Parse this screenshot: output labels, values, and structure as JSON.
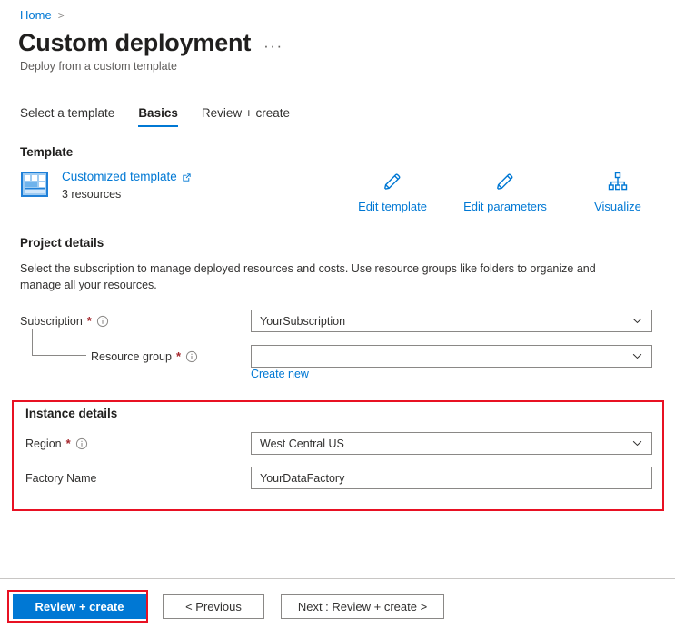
{
  "breadcrumb": {
    "items": [
      {
        "label": "Home",
        "link": true
      }
    ],
    "separator": ">"
  },
  "header": {
    "title": "Custom deployment",
    "subtitle": "Deploy from a custom template",
    "more_label": "···"
  },
  "tabs": [
    {
      "label": "Select a template",
      "active": false
    },
    {
      "label": "Basics",
      "active": true
    },
    {
      "label": "Review + create",
      "active": false
    }
  ],
  "template": {
    "heading": "Template",
    "link_label": "Customized template",
    "resource_count": "3 resources",
    "actions": [
      {
        "label": "Edit template",
        "icon": "pencil-icon"
      },
      {
        "label": "Edit parameters",
        "icon": "pencil-icon"
      },
      {
        "label": "Visualize",
        "icon": "hierarchy-icon"
      }
    ]
  },
  "project_details": {
    "heading": "Project details",
    "description": "Select the subscription to manage deployed resources and costs. Use resource groups like folders to organize and manage all your resources.",
    "subscription": {
      "label": "Subscription",
      "required": "*",
      "value": "YourSubscription"
    },
    "resource_group": {
      "label": "Resource group",
      "required": "*",
      "value": "",
      "create_new_label": "Create new"
    }
  },
  "instance_details": {
    "heading": "Instance details",
    "region": {
      "label": "Region",
      "required": "*",
      "value": "West Central US"
    },
    "factory_name": {
      "label": "Factory Name",
      "value": "YourDataFactory"
    }
  },
  "footer": {
    "review_create_label": "Review + create",
    "previous_label": "< Previous",
    "next_label": "Next : Review + create >"
  },
  "colors": {
    "accent": "#0078d4",
    "highlight": "#e81123",
    "required": "#a4262c",
    "border": "#8a8886",
    "text": "#323130"
  }
}
